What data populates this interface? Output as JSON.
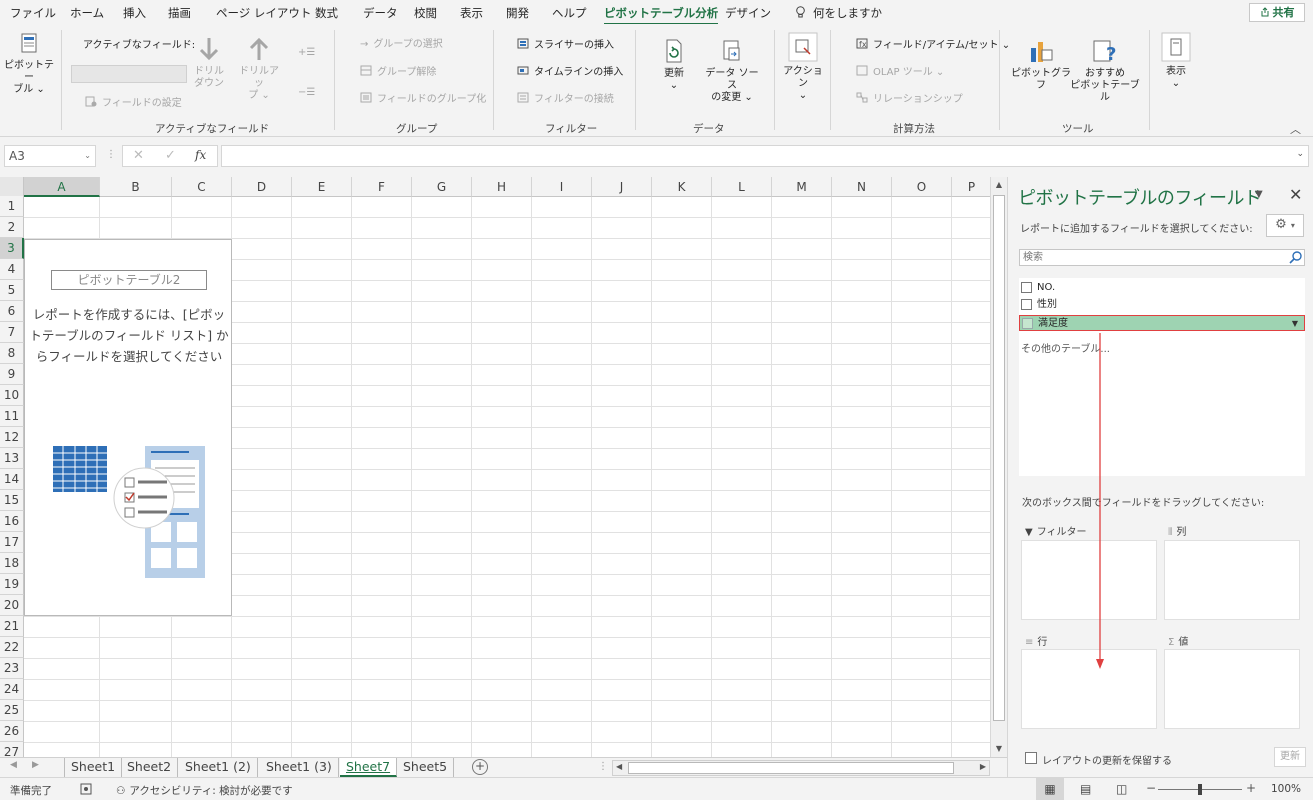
{
  "menu": {
    "tabs": [
      "ファイル",
      "ホーム",
      "挿入",
      "描画",
      "ページ レイアウト",
      "数式",
      "データ",
      "校閲",
      "表示",
      "開発",
      "ヘルプ",
      "ピボットテーブル分析",
      "デザイン"
    ],
    "active_tab": "ピボットテーブル分析",
    "tell_me": "何をしますか",
    "share": "共有"
  },
  "ribbon": {
    "pivot_table": "ピボットテー\nブル ⌄",
    "active_field_label": "アクティブなフィールド:",
    "field_settings": "フィールドの設定",
    "drill_down": "ドリル\nダウン",
    "drill_up": "ドリルアッ\nプ ⌄",
    "group_selection": "グループの選択",
    "ungroup": "グループ解除",
    "group_field": "フィールドのグループ化",
    "insert_slicer": "スライサーの挿入",
    "insert_timeline": "タイムラインの挿入",
    "filter_connections": "フィルターの接続",
    "refresh": "更新\n⌄",
    "change_source": "データ ソース\nの変更 ⌄",
    "actions": "アクション\n⌄",
    "fields_items_sets": "フィールド/アイテム/セット ⌄",
    "olap_tools": "OLAP ツール ⌄",
    "relationships": "リレーションシップ",
    "pivot_chart": "ピボットグラフ",
    "recommended": "おすすめ\nピボットテーブル",
    "show": "表示\n⌄",
    "groups": {
      "active_field": "アクティブなフィールド",
      "group": "グループ",
      "filter": "フィルター",
      "data": "データ",
      "calculation": "計算方法",
      "tools": "ツール"
    }
  },
  "formula_bar": {
    "name_box": "A3",
    "fx": "fx",
    "formula": ""
  },
  "grid": {
    "columns": [
      "A",
      "B",
      "C",
      "D",
      "E",
      "F",
      "G",
      "H",
      "I",
      "J",
      "K",
      "L",
      "M",
      "N",
      "O",
      "P"
    ],
    "rows": [
      "1",
      "2",
      "3",
      "4",
      "5",
      "6",
      "7",
      "8",
      "9",
      "10",
      "11",
      "12",
      "13",
      "14",
      "15",
      "16",
      "17",
      "18",
      "19",
      "20",
      "21",
      "22",
      "23",
      "24",
      "25",
      "26",
      "27"
    ],
    "selected_col": "A",
    "selected_row": "3"
  },
  "pivot_placeholder": {
    "name": "ピボットテーブル2",
    "instructions": "レポートを作成するには、[ピボットテーブルのフィールド リスト] からフィールドを選択してください"
  },
  "sheets": {
    "tabs": [
      "Sheet1",
      "Sheet2",
      "Sheet1 (2)",
      "Sheet1 (3)",
      "Sheet7",
      "Sheet5"
    ],
    "active": "Sheet7"
  },
  "status": {
    "ready": "準備完了",
    "accessibility": "アクセシビリティ: 検討が必要です",
    "zoom": "100%"
  },
  "field_pane": {
    "title": "ピボットテーブルのフィールド",
    "instruction": "レポートに追加するフィールドを選択してください:",
    "search_placeholder": "検索",
    "fields": [
      "NO.",
      "性別",
      "満足度"
    ],
    "dragging_field": "満足度",
    "other_tables": "その他のテーブル...",
    "drag_instruction": "次のボックス間でフィールドをドラッグしてください:",
    "areas": {
      "filters": "フィルター",
      "columns": "列",
      "rows": "行",
      "values": "値"
    },
    "defer_update": "レイアウトの更新を保留する",
    "update": "更新"
  },
  "colors": {
    "accent": "#217346",
    "drag_fill": "#9ed3b2",
    "drag_border": "#e04040",
    "arrow": "#e04040"
  }
}
